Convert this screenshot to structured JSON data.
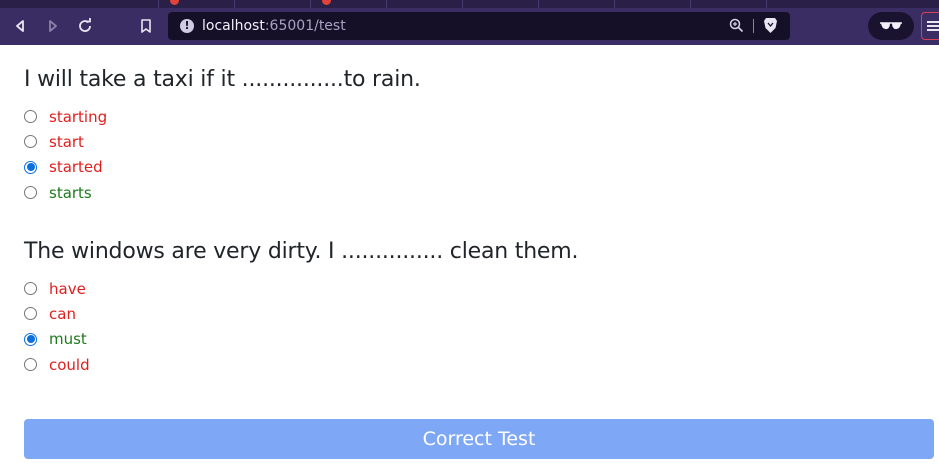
{
  "browser": {
    "url_host": "localhost",
    "url_path": ":65001/test"
  },
  "questions": [
    {
      "text": "I will take a taxi if it ...............to rain.",
      "options": [
        {
          "label": "starting",
          "status": "wrong",
          "selected": false
        },
        {
          "label": "start",
          "status": "wrong",
          "selected": false
        },
        {
          "label": "started",
          "status": "wrong",
          "selected": true
        },
        {
          "label": "starts",
          "status": "correct",
          "selected": false
        }
      ]
    },
    {
      "text": "The windows are very dirty. I ............... clean them.",
      "options": [
        {
          "label": "have",
          "status": "wrong",
          "selected": false
        },
        {
          "label": "can",
          "status": "wrong",
          "selected": false
        },
        {
          "label": "must",
          "status": "correct",
          "selected": true
        },
        {
          "label": "could",
          "status": "wrong",
          "selected": false
        }
      ]
    }
  ],
  "submit_label": "Correct Test",
  "colors": {
    "wrong": "#e01e1e",
    "correct": "#1d7a1d",
    "button": "#7ea8f6",
    "chrome": "#3a2d63"
  }
}
